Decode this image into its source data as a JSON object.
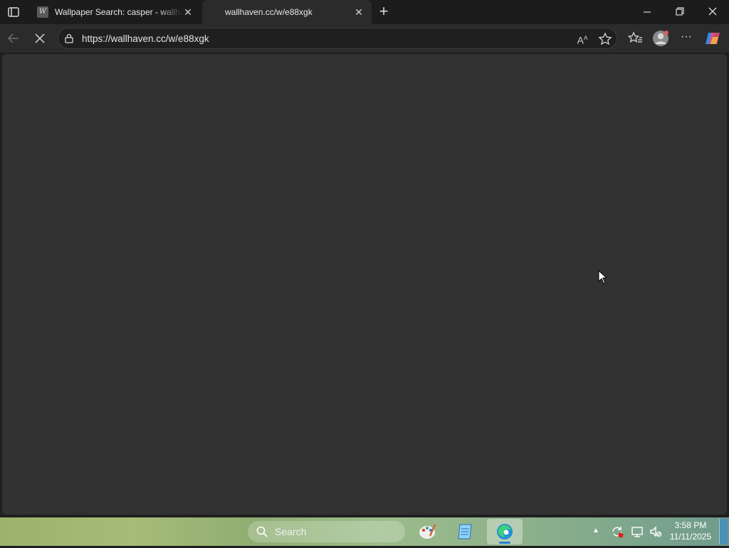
{
  "browser": {
    "tabs": [
      {
        "title": "Wallpaper Search: casper - wallhaven.cc",
        "favicon_letter": "W",
        "active": false
      },
      {
        "title": "wallhaven.cc/w/e88xgk",
        "active": true
      }
    ],
    "address_bar": {
      "url": "https://wallhaven.cc/w/e88xgk"
    },
    "icons": [
      "tab-actions-icon",
      "close-tab-icon",
      "new-tab-icon",
      "minimize-icon",
      "restore-icon",
      "close-window-icon",
      "back-icon",
      "stop-loading-icon",
      "site-info-icon",
      "read-aloud-icon",
      "favorite-star-icon",
      "favorites-icon",
      "profile-icon",
      "more-menu-icon",
      "copilot-icon"
    ]
  },
  "page": {
    "state": "loading",
    "background": "#323232"
  },
  "taskbar": {
    "search_label": "Search",
    "apps": [
      "paint-icon",
      "notepad-icon",
      "edge-icon"
    ],
    "tray_icons": [
      "show-hidden-icons",
      "sync-icon",
      "network-icon",
      "volume-icon"
    ],
    "clock": {
      "time": "3:58 PM",
      "date": "11/11/2025"
    }
  }
}
